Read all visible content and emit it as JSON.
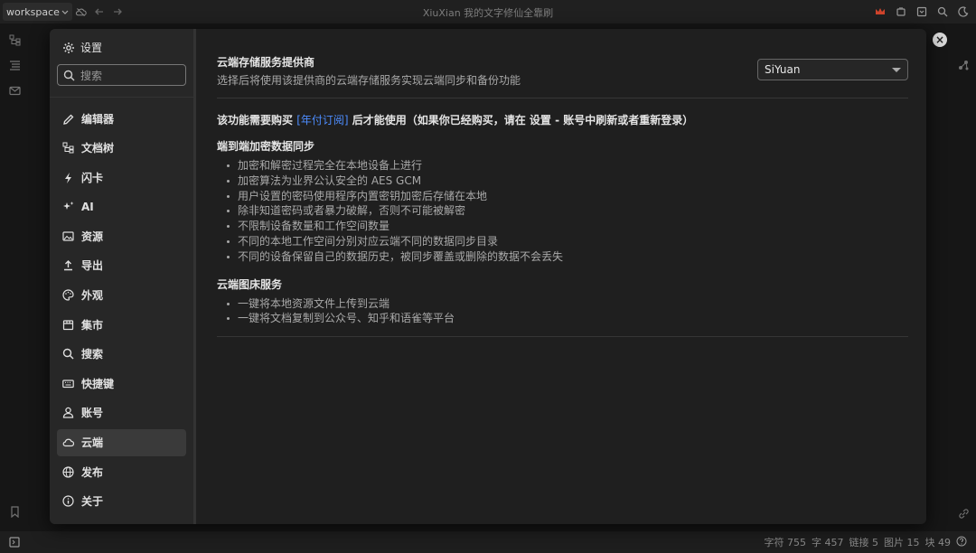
{
  "topbar": {
    "workspace_label": "workspace",
    "window_title": "XiuXian 我的文字修仙全靠刷"
  },
  "statusbar": {
    "chars": "字符 755",
    "words": "字 457",
    "links": "链接 5",
    "images": "图片 15",
    "blocks": "块 49"
  },
  "settings": {
    "title": "设置",
    "search_placeholder": "搜索",
    "nav": [
      {
        "label": "编辑器",
        "icon": "pencil-icon"
      },
      {
        "label": "文档树",
        "icon": "tree-icon"
      },
      {
        "label": "闪卡",
        "icon": "flash-icon"
      },
      {
        "label": "AI",
        "icon": "sparkle-icon"
      },
      {
        "label": "资源",
        "icon": "image-icon"
      },
      {
        "label": "导出",
        "icon": "upload-icon"
      },
      {
        "label": "外观",
        "icon": "palette-icon"
      },
      {
        "label": "集市",
        "icon": "store-icon"
      },
      {
        "label": "搜索",
        "icon": "search-icon"
      },
      {
        "label": "快捷键",
        "icon": "keyboard-icon"
      },
      {
        "label": "账号",
        "icon": "user-icon"
      },
      {
        "label": "云端",
        "icon": "cloud-icon",
        "active": true
      },
      {
        "label": "发布",
        "icon": "globe-icon"
      },
      {
        "label": "关于",
        "icon": "info-icon"
      }
    ]
  },
  "cloud": {
    "provider_title": "云端存储服务提供商",
    "provider_desc": "选择后将使用该提供商的云端存储服务实现云端同步和备份功能",
    "provider_value": "SiYuan",
    "notice_before": "该功能需要购买 ",
    "notice_link": "[年付订阅]",
    "notice_after": " 后才能使用（如果你已经购买，请在 设置 - 账号中刷新或者重新登录）",
    "e2e_title": "端到端加密数据同步",
    "e2e_items": [
      "加密和解密过程完全在本地设备上进行",
      "加密算法为业界公认安全的 AES GCM",
      "用户设置的密码使用程序内置密钥加密后存储在本地",
      "除非知道密码或者暴力破解，否则不可能被解密",
      "不限制设备数量和工作空间数量",
      "不同的本地工作空间分别对应云端不同的数据同步目录",
      "不同的设备保留自己的数据历史，被同步覆盖或删除的数据不会丢失"
    ],
    "bed_title": "云端图床服务",
    "bed_items": [
      "一键将本地资源文件上传到云端",
      "一键将文档复制到公众号、知乎和语雀等平台"
    ]
  }
}
